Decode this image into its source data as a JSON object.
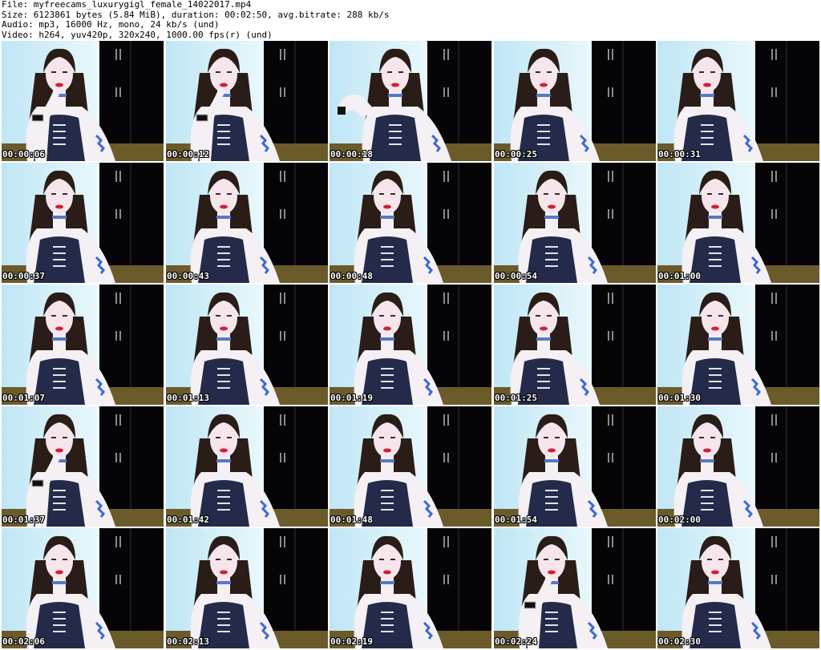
{
  "header": {
    "file_line": "File: myfreecams_luxurygigl_female_14022017.mp4",
    "size_line": "Size: 6123861 bytes (5.84 MiB), duration: 00:02:50, avg.bitrate: 288 kb/s",
    "audio_line": "Audio: mp3, 16000 Hz, mono, 24 kb/s (und)",
    "video_line": "Video: h264, yuv420p, 320x240, 1000.00 fps(r) (und)"
  },
  "thumbnails": [
    {
      "timestamp": "00:00:06",
      "pose": "hand-mouth"
    },
    {
      "timestamp": "00:00:12",
      "pose": "hand-mouth"
    },
    {
      "timestamp": "00:00:18",
      "pose": "arm-raised"
    },
    {
      "timestamp": "00:00:25",
      "pose": "lean"
    },
    {
      "timestamp": "00:00:31",
      "pose": "lean"
    },
    {
      "timestamp": "00:00:37",
      "pose": "down"
    },
    {
      "timestamp": "00:00:43",
      "pose": "down"
    },
    {
      "timestamp": "00:00:48",
      "pose": "front"
    },
    {
      "timestamp": "00:00:54",
      "pose": "front"
    },
    {
      "timestamp": "00:01:00",
      "pose": "front"
    },
    {
      "timestamp": "00:01:07",
      "pose": "front"
    },
    {
      "timestamp": "00:01:13",
      "pose": "front"
    },
    {
      "timestamp": "00:01:19",
      "pose": "front"
    },
    {
      "timestamp": "00:01:25",
      "pose": "lean"
    },
    {
      "timestamp": "00:01:30",
      "pose": "front"
    },
    {
      "timestamp": "00:01:37",
      "pose": "hand-mouth"
    },
    {
      "timestamp": "00:01:42",
      "pose": "front"
    },
    {
      "timestamp": "00:01:48",
      "pose": "front"
    },
    {
      "timestamp": "00:01:54",
      "pose": "front"
    },
    {
      "timestamp": "00:02:00",
      "pose": "lean"
    },
    {
      "timestamp": "00:02:06",
      "pose": "front"
    },
    {
      "timestamp": "00:02:13",
      "pose": "front"
    },
    {
      "timestamp": "00:02:19",
      "pose": "front"
    },
    {
      "timestamp": "00:02:24",
      "pose": "hand-mouth"
    },
    {
      "timestamp": "00:02:30",
      "pose": "front"
    }
  ],
  "colors": {
    "wall": "#bfe6f5",
    "wall_bright": "#e9f8fc",
    "wardrobe": "#050507",
    "hair": "#2a1c16",
    "skin": "#f4f0f4",
    "dress": "#232a4a",
    "floor": "#6b5a2a",
    "lips": "#d0203a"
  }
}
